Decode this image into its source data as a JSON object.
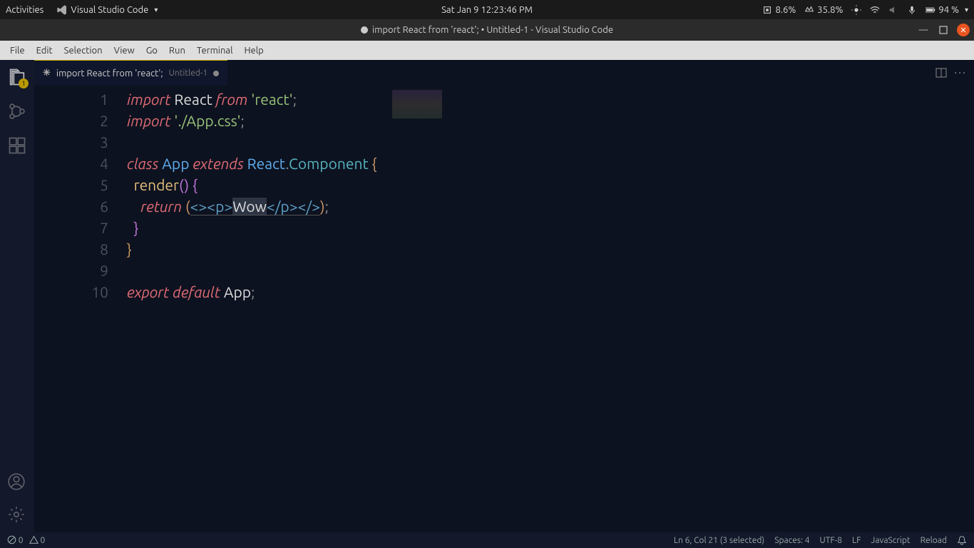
{
  "system_bar": {
    "activities": "Activities",
    "app_menu": "Visual Studio Code",
    "datetime": "Sat Jan 9  12:23:46 PM",
    "cpu_pct": "8.6%",
    "mem_pct": "35.8%",
    "battery": "94 %"
  },
  "titlebar": {
    "text": "import React from 'react'; • Untitled-1 - Visual Studio Code"
  },
  "menu": [
    "File",
    "Edit",
    "Selection",
    "View",
    "Go",
    "Run",
    "Terminal",
    "Help"
  ],
  "activity_badge": "1",
  "tab": {
    "filename": "import React from 'react';",
    "subtitle": "Untitled-1"
  },
  "code": {
    "lines": [
      {
        "n": 1,
        "tokens": [
          [
            "kw2",
            "import"
          ],
          [
            "sp",
            " "
          ],
          [
            "var",
            "React"
          ],
          [
            "sp",
            " "
          ],
          [
            "kw2",
            "from"
          ],
          [
            "sp",
            " "
          ],
          [
            "str",
            "'react'"
          ],
          [
            "punc",
            ";"
          ]
        ]
      },
      {
        "n": 2,
        "tokens": [
          [
            "kw2",
            "import"
          ],
          [
            "sp",
            " "
          ],
          [
            "str",
            "'./App.css'"
          ],
          [
            "punc",
            ";"
          ]
        ]
      },
      {
        "n": 3,
        "tokens": []
      },
      {
        "n": 4,
        "tokens": [
          [
            "kw2",
            "class"
          ],
          [
            "sp",
            " "
          ],
          [
            "type",
            "App"
          ],
          [
            "sp",
            " "
          ],
          [
            "kw2",
            "extends"
          ],
          [
            "sp",
            " "
          ],
          [
            "type",
            "React"
          ],
          [
            "punc",
            "."
          ],
          [
            "comp",
            "Component"
          ],
          [
            "sp",
            " "
          ],
          [
            "brace1",
            "{"
          ]
        ]
      },
      {
        "n": 5,
        "tokens": [
          [
            "sp",
            "  "
          ],
          [
            "fn",
            "render"
          ],
          [
            "paren2",
            "("
          ],
          [
            "paren2",
            ")"
          ],
          [
            "sp",
            " "
          ],
          [
            "brace2",
            "{"
          ]
        ]
      },
      {
        "n": 6,
        "tokens": [
          [
            "sp",
            "    "
          ],
          [
            "kw2",
            "return"
          ],
          [
            "sp",
            " "
          ],
          [
            "paren1",
            "("
          ],
          [
            "ulstart",
            ""
          ],
          [
            "tag",
            "<>"
          ],
          [
            "tag",
            "<p>"
          ],
          [
            "selstart",
            ""
          ],
          [
            "var",
            "Wow"
          ],
          [
            "selend",
            ""
          ],
          [
            "tag",
            "</p>"
          ],
          [
            "tag",
            "</>"
          ],
          [
            "ulend",
            ""
          ],
          [
            "paren1",
            ")"
          ],
          [
            "punc",
            ";"
          ]
        ]
      },
      {
        "n": 7,
        "tokens": [
          [
            "sp",
            "  "
          ],
          [
            "brace2",
            "}"
          ]
        ]
      },
      {
        "n": 8,
        "tokens": [
          [
            "brace1",
            "}"
          ]
        ]
      },
      {
        "n": 9,
        "tokens": []
      },
      {
        "n": 10,
        "tokens": [
          [
            "kw2",
            "export"
          ],
          [
            "sp",
            " "
          ],
          [
            "kw2",
            "default"
          ],
          [
            "sp",
            " "
          ],
          [
            "var",
            "App"
          ],
          [
            "punc",
            ";"
          ]
        ]
      }
    ]
  },
  "statusbar": {
    "errors": "0",
    "warnings": "0",
    "cursor": "Ln 6, Col 21 (3 selected)",
    "spaces": "Spaces: 4",
    "encoding": "UTF-8",
    "eol": "LF",
    "lang": "JavaScript",
    "reload": "Reload"
  }
}
